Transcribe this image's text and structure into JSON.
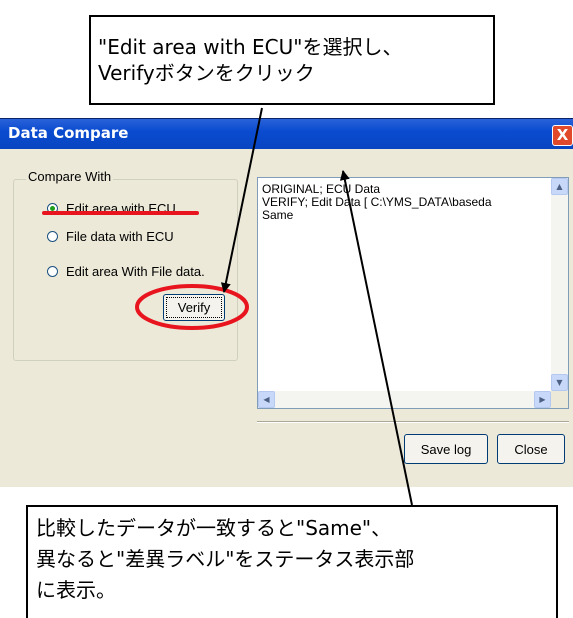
{
  "callout_top": {
    "lines": [
      "\"Edit area with ECU\"を選択し、",
      "Verifyボタンをクリック"
    ]
  },
  "callout_bottom": {
    "lines": [
      "比較したデータが一致すると\"Same\"、",
      "異なると\"差異ラベル\"をステータス表示部",
      "に表示。"
    ]
  },
  "dialog": {
    "title": "Data Compare",
    "close_glyph": "X",
    "group_label": "Compare With",
    "options": [
      {
        "label": "Edit area with ECU",
        "selected": true
      },
      {
        "label": "File data with ECU",
        "selected": false
      },
      {
        "label": "Edit area With File data.",
        "selected": false
      }
    ],
    "verify_label": "Verify",
    "log_lines": [
      "ORIGINAL;  ECU Data",
      "VERIFY;  Edit Data  [ C:\\YMS_DATA\\baseda",
      "Same"
    ],
    "save_log_label": "Save log",
    "close_label": "Close"
  },
  "colors": {
    "title_bar": "#0a4bd0",
    "annotation_red": "#e8141e",
    "dialog_bg": "#ece9d8"
  },
  "icons": {
    "radio_selected": "radio-selected-icon",
    "scroll_up": "scroll-up-arrow-icon",
    "scroll_down": "scroll-down-arrow-icon",
    "scroll_left": "scroll-left-arrow-icon",
    "scroll_right": "scroll-right-arrow-icon"
  }
}
